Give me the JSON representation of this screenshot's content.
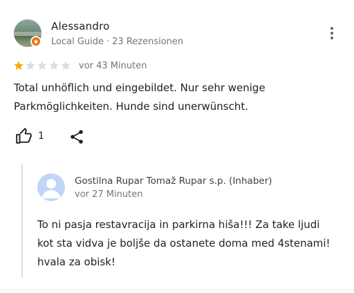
{
  "review": {
    "author": "Alessandro",
    "author_meta": {
      "role": "Local Guide",
      "separator": "·",
      "count": "23 Rezensionen"
    },
    "rating": 1,
    "rating_max": 5,
    "time": "vor 43 Minuten",
    "text_lines": [
      "Total unhöflich und eingebildet. Nur sehr wenige",
      "Parkmöglichkeiten. Hunde sind unerwünscht."
    ],
    "likes": "1"
  },
  "reply": {
    "owner": "Gostilna Rupar Tomaž Rupar s.p. (Inhaber)",
    "time": "vor 27 Minuten",
    "text_lines": [
      "To ni pasja restavracija in parkirna hiša!!! Za take ljudi",
      "kot sta vidva je boljše da ostanete doma med 4stenami!",
      "hvala za obisk!"
    ]
  },
  "colors": {
    "star_filled": "#f9ab00",
    "star_empty": "#dadce0",
    "badge": "#e8710a",
    "owner_avatar_bg": "#c2d5f5",
    "owner_avatar_fg": "#ffffff"
  },
  "icons": {
    "more": "more-vert-icon",
    "like": "thumb-up-icon",
    "share": "share-icon",
    "badge": "local-guide-badge-icon"
  }
}
